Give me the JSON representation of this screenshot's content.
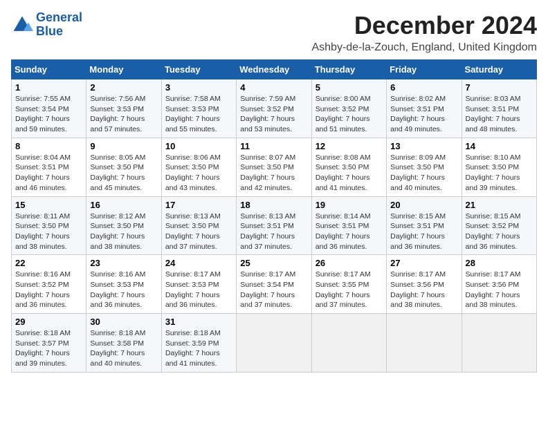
{
  "header": {
    "logo_line1": "General",
    "logo_line2": "Blue",
    "title": "December 2024",
    "subtitle": "Ashby-de-la-Zouch, England, United Kingdom"
  },
  "weekdays": [
    "Sunday",
    "Monday",
    "Tuesday",
    "Wednesday",
    "Thursday",
    "Friday",
    "Saturday"
  ],
  "weeks": [
    [
      {
        "day": 1,
        "sunrise": "7:55 AM",
        "sunset": "3:54 PM",
        "daylight": "7 hours and 59 minutes."
      },
      {
        "day": 2,
        "sunrise": "7:56 AM",
        "sunset": "3:53 PM",
        "daylight": "7 hours and 57 minutes."
      },
      {
        "day": 3,
        "sunrise": "7:58 AM",
        "sunset": "3:53 PM",
        "daylight": "7 hours and 55 minutes."
      },
      {
        "day": 4,
        "sunrise": "7:59 AM",
        "sunset": "3:52 PM",
        "daylight": "7 hours and 53 minutes."
      },
      {
        "day": 5,
        "sunrise": "8:00 AM",
        "sunset": "3:52 PM",
        "daylight": "7 hours and 51 minutes."
      },
      {
        "day": 6,
        "sunrise": "8:02 AM",
        "sunset": "3:51 PM",
        "daylight": "7 hours and 49 minutes."
      },
      {
        "day": 7,
        "sunrise": "8:03 AM",
        "sunset": "3:51 PM",
        "daylight": "7 hours and 48 minutes."
      }
    ],
    [
      {
        "day": 8,
        "sunrise": "8:04 AM",
        "sunset": "3:51 PM",
        "daylight": "7 hours and 46 minutes."
      },
      {
        "day": 9,
        "sunrise": "8:05 AM",
        "sunset": "3:50 PM",
        "daylight": "7 hours and 45 minutes."
      },
      {
        "day": 10,
        "sunrise": "8:06 AM",
        "sunset": "3:50 PM",
        "daylight": "7 hours and 43 minutes."
      },
      {
        "day": 11,
        "sunrise": "8:07 AM",
        "sunset": "3:50 PM",
        "daylight": "7 hours and 42 minutes."
      },
      {
        "day": 12,
        "sunrise": "8:08 AM",
        "sunset": "3:50 PM",
        "daylight": "7 hours and 41 minutes."
      },
      {
        "day": 13,
        "sunrise": "8:09 AM",
        "sunset": "3:50 PM",
        "daylight": "7 hours and 40 minutes."
      },
      {
        "day": 14,
        "sunrise": "8:10 AM",
        "sunset": "3:50 PM",
        "daylight": "7 hours and 39 minutes."
      }
    ],
    [
      {
        "day": 15,
        "sunrise": "8:11 AM",
        "sunset": "3:50 PM",
        "daylight": "7 hours and 38 minutes."
      },
      {
        "day": 16,
        "sunrise": "8:12 AM",
        "sunset": "3:50 PM",
        "daylight": "7 hours and 38 minutes."
      },
      {
        "day": 17,
        "sunrise": "8:13 AM",
        "sunset": "3:50 PM",
        "daylight": "7 hours and 37 minutes."
      },
      {
        "day": 18,
        "sunrise": "8:13 AM",
        "sunset": "3:51 PM",
        "daylight": "7 hours and 37 minutes."
      },
      {
        "day": 19,
        "sunrise": "8:14 AM",
        "sunset": "3:51 PM",
        "daylight": "7 hours and 36 minutes."
      },
      {
        "day": 20,
        "sunrise": "8:15 AM",
        "sunset": "3:51 PM",
        "daylight": "7 hours and 36 minutes."
      },
      {
        "day": 21,
        "sunrise": "8:15 AM",
        "sunset": "3:52 PM",
        "daylight": "7 hours and 36 minutes."
      }
    ],
    [
      {
        "day": 22,
        "sunrise": "8:16 AM",
        "sunset": "3:52 PM",
        "daylight": "7 hours and 36 minutes."
      },
      {
        "day": 23,
        "sunrise": "8:16 AM",
        "sunset": "3:53 PM",
        "daylight": "7 hours and 36 minutes."
      },
      {
        "day": 24,
        "sunrise": "8:17 AM",
        "sunset": "3:53 PM",
        "daylight": "7 hours and 36 minutes."
      },
      {
        "day": 25,
        "sunrise": "8:17 AM",
        "sunset": "3:54 PM",
        "daylight": "7 hours and 37 minutes."
      },
      {
        "day": 26,
        "sunrise": "8:17 AM",
        "sunset": "3:55 PM",
        "daylight": "7 hours and 37 minutes."
      },
      {
        "day": 27,
        "sunrise": "8:17 AM",
        "sunset": "3:56 PM",
        "daylight": "7 hours and 38 minutes."
      },
      {
        "day": 28,
        "sunrise": "8:17 AM",
        "sunset": "3:56 PM",
        "daylight": "7 hours and 38 minutes."
      }
    ],
    [
      {
        "day": 29,
        "sunrise": "8:18 AM",
        "sunset": "3:57 PM",
        "daylight": "7 hours and 39 minutes."
      },
      {
        "day": 30,
        "sunrise": "8:18 AM",
        "sunset": "3:58 PM",
        "daylight": "7 hours and 40 minutes."
      },
      {
        "day": 31,
        "sunrise": "8:18 AM",
        "sunset": "3:59 PM",
        "daylight": "7 hours and 41 minutes."
      },
      null,
      null,
      null,
      null
    ]
  ],
  "labels": {
    "sunrise_prefix": "Sunrise: ",
    "sunset_prefix": "Sunset: ",
    "daylight_prefix": "Daylight: "
  }
}
